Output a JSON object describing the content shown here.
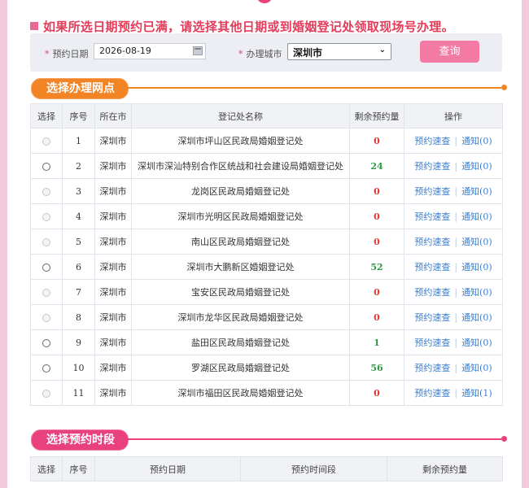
{
  "notice": "如果所选日期预约已满，请选择其他日期或到婚姻登记处领取现场号办理。",
  "search": {
    "date_label": "预约日期",
    "date_value": "2026-08-19",
    "city_label": "办理城市",
    "city_value": "深圳市",
    "query_button": "查询"
  },
  "section_offices": {
    "title": "选择办理网点"
  },
  "offices_table": {
    "headers": [
      "选择",
      "序号",
      "所在市",
      "登记处名称",
      "剩余预约量",
      "操作"
    ],
    "rows": [
      {
        "index": "1",
        "city": "深圳市",
        "name": "深圳市坪山区民政局婚姻登记处",
        "remaining": "0",
        "enabled": false,
        "action": "预约速查",
        "notify": "通知(0)"
      },
      {
        "index": "2",
        "city": "深圳市",
        "name": "深圳市深汕特别合作区统战和社会建设局婚姻登记处",
        "remaining": "24",
        "enabled": true,
        "action": "预约速查",
        "notify": "通知(0)"
      },
      {
        "index": "3",
        "city": "深圳市",
        "name": "龙岗区民政局婚姻登记处",
        "remaining": "0",
        "enabled": false,
        "action": "预约速查",
        "notify": "通知(0)"
      },
      {
        "index": "4",
        "city": "深圳市",
        "name": "深圳市光明区民政局婚姻登记处",
        "remaining": "0",
        "enabled": false,
        "action": "预约速查",
        "notify": "通知(0)"
      },
      {
        "index": "5",
        "city": "深圳市",
        "name": "南山区民政局婚姻登记处",
        "remaining": "0",
        "enabled": false,
        "action": "预约速查",
        "notify": "通知(0)"
      },
      {
        "index": "6",
        "city": "深圳市",
        "name": "深圳市大鹏新区婚姻登记处",
        "remaining": "52",
        "enabled": true,
        "action": "预约速查",
        "notify": "通知(0)"
      },
      {
        "index": "7",
        "city": "深圳市",
        "name": "宝安区民政局婚姻登记处",
        "remaining": "0",
        "enabled": false,
        "action": "预约速查",
        "notify": "通知(0)"
      },
      {
        "index": "8",
        "city": "深圳市",
        "name": "深圳市龙华区民政局婚姻登记处",
        "remaining": "0",
        "enabled": false,
        "action": "预约速查",
        "notify": "通知(0)"
      },
      {
        "index": "9",
        "city": "深圳市",
        "name": "盐田区民政局婚姻登记处",
        "remaining": "1",
        "enabled": true,
        "action": "预约速查",
        "notify": "通知(0)"
      },
      {
        "index": "10",
        "city": "深圳市",
        "name": "罗湖区民政局婚姻登记处",
        "remaining": "56",
        "enabled": true,
        "action": "预约速查",
        "notify": "通知(0)"
      },
      {
        "index": "11",
        "city": "深圳市",
        "name": "深圳市福田区民政局婚姻登记处",
        "remaining": "0",
        "enabled": false,
        "action": "预约速查",
        "notify": "通知(1)"
      }
    ]
  },
  "section_timeslots": {
    "title": "选择预约时段"
  },
  "timeslots_table": {
    "headers": [
      "选择",
      "序号",
      "预约日期",
      "预约时间段",
      "剩余预约量"
    ]
  },
  "colors": {
    "accent_orange": "#f28426",
    "accent_pink": "#e8417e",
    "query_button": "#f37aa2",
    "zero_count": "#e03a3a",
    "available_count": "#2f9a46",
    "link": "#3b7fd1"
  }
}
